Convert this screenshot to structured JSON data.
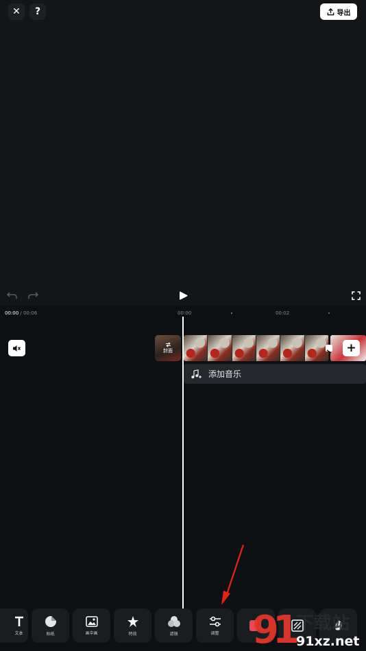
{
  "top_bar": {
    "close_label": "✕",
    "help_label": "?",
    "export_label": "导出"
  },
  "timeline": {
    "current_time": "00:00",
    "total_time": "/ 00:06",
    "tick_1": "00:00",
    "tick_2": "00:02",
    "cover_label": "封面",
    "music_label": "添加音乐"
  },
  "toolbar": {
    "items": [
      {
        "label": "文本",
        "icon": "text-icon"
      },
      {
        "label": "贴纸",
        "icon": "sticker-icon"
      },
      {
        "label": "画中画",
        "icon": "picture-in-picture-icon"
      },
      {
        "label": "特效",
        "icon": "effects-icon"
      },
      {
        "label": "滤镜",
        "icon": "filter-icon"
      },
      {
        "label": "调整",
        "icon": "adjust-icon"
      },
      {
        "label": "",
        "icon": "record-icon"
      },
      {
        "label": "",
        "icon": "background-icon"
      },
      {
        "label": "",
        "icon": "beauty-icon"
      }
    ]
  },
  "watermark": {
    "text": "91xz.net",
    "chars": "下载站"
  },
  "colors": {
    "background": "#0d0f12",
    "preview": "#131517",
    "annotation_arrow": "#e0261b"
  }
}
